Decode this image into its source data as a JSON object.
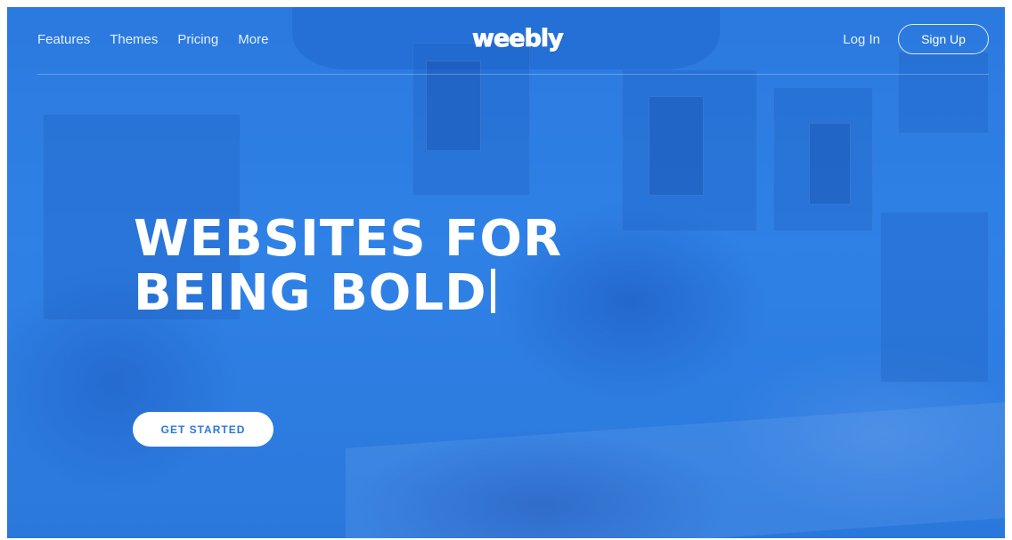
{
  "nav": {
    "links": [
      {
        "label": "Features"
      },
      {
        "label": "Themes"
      },
      {
        "label": "Pricing"
      },
      {
        "label": "More"
      }
    ],
    "logo": "weebly",
    "login_label": "Log In",
    "signup_label": "Sign Up"
  },
  "hero": {
    "title_line1": "WEBSITES FOR",
    "title_line2": "BEING BOLD",
    "cta_label": "GET STARTED"
  },
  "colors": {
    "brand_blue": "#2f7fe0",
    "text_white": "#ffffff"
  }
}
